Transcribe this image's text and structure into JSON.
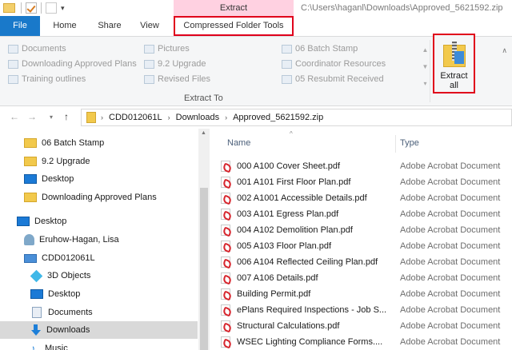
{
  "window": {
    "context_tab_label": "Extract",
    "path_title": "C:\\Users\\haganl\\Downloads\\Approved_5621592.zip"
  },
  "tabs": {
    "file": "File",
    "home": "Home",
    "share": "Share",
    "view": "View",
    "compressed": "Compressed Folder Tools"
  },
  "ribbon": {
    "destinations": [
      "Documents",
      "Downloading Approved Plans",
      "Training outlines",
      "Pictures",
      "9.2 Upgrade",
      "Revised Files",
      "06 Batch Stamp",
      "Coordinator Resources",
      "05 Resubmit Received"
    ],
    "group_label": "Extract To",
    "extract_all_line1": "Extract",
    "extract_all_line2": "all"
  },
  "address": {
    "crumbs": [
      "CDD012061L",
      "Downloads",
      "Approved_5621592.zip"
    ]
  },
  "nav": {
    "items": [
      "06 Batch Stamp",
      "9.2 Upgrade",
      "Desktop",
      "Downloading Approved Plans",
      "Desktop",
      "Eruhow-Hagan, Lisa",
      "CDD012061L",
      "3D Objects",
      "Desktop",
      "Documents",
      "Downloads",
      "Music"
    ]
  },
  "files": {
    "col_name": "Name",
    "col_type": "Type",
    "rows": [
      {
        "name": "000 A100 Cover Sheet.pdf",
        "type": "Adobe Acrobat Document"
      },
      {
        "name": "001 A101 First Floor Plan.pdf",
        "type": "Adobe Acrobat Document"
      },
      {
        "name": "002 A1001 Accessible Details.pdf",
        "type": "Adobe Acrobat Document"
      },
      {
        "name": "003 A101 Egress Plan.pdf",
        "type": "Adobe Acrobat Document"
      },
      {
        "name": "004 A102 Demolition Plan.pdf",
        "type": "Adobe Acrobat Document"
      },
      {
        "name": "005 A103 Floor Plan.pdf",
        "type": "Adobe Acrobat Document"
      },
      {
        "name": "006 A104 Reflected Ceiling Plan.pdf",
        "type": "Adobe Acrobat Document"
      },
      {
        "name": "007 A106 Details.pdf",
        "type": "Adobe Acrobat Document"
      },
      {
        "name": "Building Permit.pdf",
        "type": "Adobe Acrobat Document"
      },
      {
        "name": "ePlans Required Inspections - Job S...",
        "type": "Adobe Acrobat Document"
      },
      {
        "name": "Structural Calculations.pdf",
        "type": "Adobe Acrobat Document"
      },
      {
        "name": "WSEC Lighting Compliance Forms....",
        "type": "Adobe Acrobat Document"
      }
    ]
  }
}
